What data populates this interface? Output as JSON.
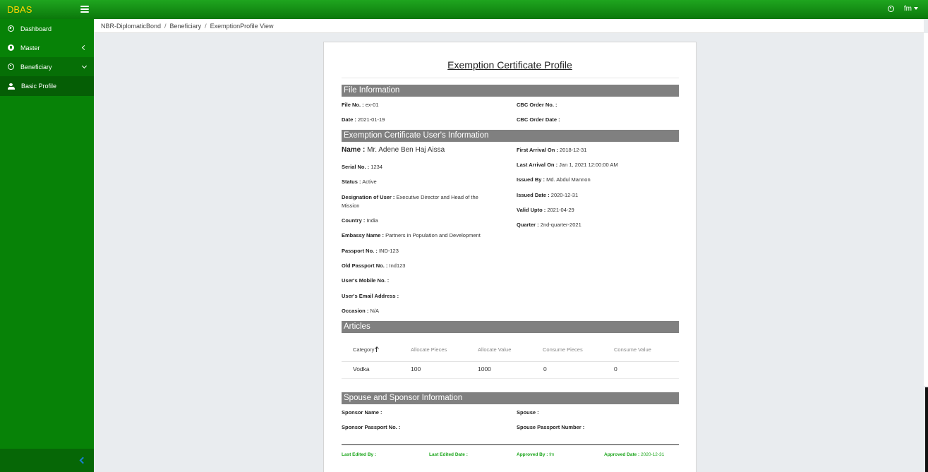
{
  "app": {
    "brand": "DBAS",
    "user": "fm"
  },
  "sidebar": {
    "items": [
      {
        "label": "Dashboard"
      },
      {
        "label": "Master"
      },
      {
        "label": "Beneficiary"
      },
      {
        "label": "Basic Profile"
      }
    ]
  },
  "breadcrumb": [
    "NBR-DiplomaticBond",
    "Beneficiary",
    "ExemptionProfile View"
  ],
  "card": {
    "title": "Exemption Certificate Profile",
    "sections": {
      "file": "File Information",
      "user": "Exemption Certificate User's Information",
      "articles": "Articles",
      "spouse": "Spouse and Sponsor Information"
    },
    "file_info": {
      "file_no": {
        "label": "File No. :",
        "value": "ex-01"
      },
      "date": {
        "label": "Date :",
        "value": "2021-01-19"
      },
      "cbc_order_no": {
        "label": "CBC Order No. :",
        "value": ""
      },
      "cbc_order_date": {
        "label": "CBC Order Date :",
        "value": ""
      }
    },
    "user_info": {
      "name": {
        "label": "Name :",
        "value": "Mr. Adene Ben Haj Aissa"
      },
      "serial_no": {
        "label": "Serial No. :",
        "value": "1234"
      },
      "status": {
        "label": "Status :",
        "value": "Active"
      },
      "designation_label": "Designation of User :",
      "designation_line1": "Executive Director and Head of the",
      "designation_line2": "Mission",
      "country": {
        "label": "Country :",
        "value": "India"
      },
      "embassy": {
        "label": "Embassy Name :",
        "value": "Partners in Population and Development"
      },
      "passport": {
        "label": "Passport No. :",
        "value": "IND-123"
      },
      "old_passport": {
        "label": "Old Passport No. :",
        "value": "Ind123"
      },
      "mobile": {
        "label": "User's Mobile No. :",
        "value": ""
      },
      "email": {
        "label": "User's Email Address :",
        "value": ""
      },
      "occasion": {
        "label": "Occasion :",
        "value": "N/A"
      },
      "first_arrival": {
        "label": "First Arrival On :",
        "value": "2018-12-31"
      },
      "last_arrival": {
        "label": "Last Arrival On :",
        "value": "Jan 1, 2021 12:00:00 AM"
      },
      "issued_by": {
        "label": "Issued By :",
        "value": "Md. Abdul Mannon"
      },
      "issued_date": {
        "label": "Issued Date :",
        "value": "2020-12-31"
      },
      "valid_upto": {
        "label": "Valid Upto :",
        "value": "2021-04-29"
      },
      "quarter": {
        "label": "Quarter :",
        "value": "2nd-quarter-2021"
      }
    },
    "articles": {
      "headers": [
        "Category",
        "Allocate Pieces",
        "Allocate Value",
        "Consume Pieces",
        "Consume Value"
      ],
      "rows": [
        [
          "Vodka",
          "100",
          "1000",
          "0",
          "0"
        ]
      ]
    },
    "spouse_info": {
      "sponsor_name": {
        "label": "Sponsor Name :",
        "value": ""
      },
      "sponsor_passport": {
        "label": "Sponsor Passport No. :",
        "value": ""
      },
      "spouse": {
        "label": "Spouse :",
        "value": ""
      },
      "spouse_passport": {
        "label": "Spouse Passport Number :",
        "value": ""
      }
    },
    "footer": {
      "last_edited_by": {
        "label": "Last Edited By :",
        "value": ""
      },
      "last_edited_date": {
        "label": "Last Edited Date :",
        "value": ""
      },
      "approved_by": {
        "label": "Approved By :",
        "value": "fm"
      },
      "approved_date": {
        "label": "Approved Date :",
        "value": "2020-12-31"
      }
    }
  },
  "colors": {
    "navbar": "#0b8a0b",
    "sidebar": "#078207",
    "brand": "#ffd400",
    "section": "#808080",
    "footer_text": "#1aa51a"
  }
}
